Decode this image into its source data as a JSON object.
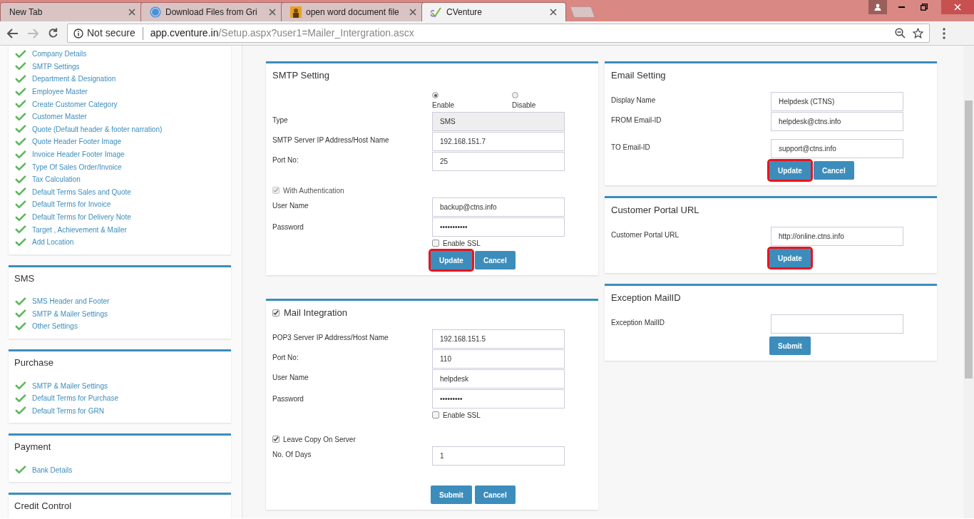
{
  "browser": {
    "tabs": [
      {
        "title": "New Tab",
        "kind": "none",
        "selected": false
      },
      {
        "title": "Download Files from Gri",
        "kind": "asp",
        "selected": false
      },
      {
        "title": "open word document file",
        "kind": "picture",
        "selected": false
      },
      {
        "title": "CVenture",
        "kind": "check",
        "selected": true
      }
    ],
    "address": {
      "security": "Not secure",
      "host": "app.cventure.in",
      "path": "/Setup.aspx?user1=Mailer_Intergration.ascx"
    }
  },
  "sidebar": [
    {
      "items": [
        "Company Details",
        "SMTP Settings",
        "Department & Designation",
        "Employee Master",
        "Create Customer Category",
        "Customer Master",
        "Quote (Default header & footer narration)",
        "Quote Header Footer Image",
        "Invoice Header Footer Image",
        "Type Of Sales Order/Invoice",
        "Tax Calculation",
        "Default Terms Sales and Quote",
        "Default Terms for Invoice",
        "Default Terms for Delivery Note",
        "Target , Achievement & Mailer",
        "Add Location"
      ]
    },
    {
      "title": "SMS",
      "items": [
        "SMS Header and Footer",
        "SMTP & Mailer Settings",
        "Other Settings"
      ]
    },
    {
      "title": "Purchase",
      "items": [
        "SMTP & Mailer Settings",
        "Default Terms for Purchase",
        "Default Terms for GRN"
      ]
    },
    {
      "title": "Payment",
      "items": [
        "Bank Details"
      ]
    },
    {
      "title": "Credit Control"
    }
  ],
  "columns": [
    [
      {
        "title": "SMTP Setting",
        "rows": [
          {
            "kind": "radio",
            "options": [
              {
                "label": "Enable",
                "selected": true
              },
              {
                "label": "Disable",
                "selected": false
              }
            ]
          },
          {
            "kind": "field",
            "label": "Type",
            "value": "SMS",
            "disabled": true
          },
          {
            "kind": "field",
            "label": "SMTP Server IP Address/Host Name",
            "value": "192.168.151.7",
            "disabled": false
          },
          {
            "kind": "field",
            "label": "Port No:",
            "value": "25",
            "disabled": false
          },
          {
            "kind": "checkbox",
            "label": "With Authentication",
            "checked": true,
            "disabled": true
          },
          {
            "kind": "field",
            "label": "User Name",
            "value": "backup@ctns.info",
            "disabled": false
          },
          {
            "kind": "field",
            "label": "Password",
            "value": "•••••••••••",
            "disabled": false,
            "option": {
              "label": "Enable SSL",
              "checked": false
            }
          },
          {
            "kind": "buttons",
            "buttons": [
              {
                "label": "Update",
                "highlighted": true
              },
              {
                "label": "Cancel",
                "highlighted": false
              }
            ]
          }
        ]
      },
      {
        "title": "Mail Integration",
        "checked": true,
        "rows": [
          {
            "kind": "field",
            "label": "POP3 Server IP Address/Host Name",
            "value": "192.168.151.5",
            "disabled": false
          },
          {
            "kind": "field",
            "label": "Port No:",
            "value": "110",
            "disabled": false
          },
          {
            "kind": "field",
            "label": "User Name",
            "value": "helpdesk",
            "disabled": false
          },
          {
            "kind": "field",
            "label": "Password",
            "value": "•••••••••",
            "disabled": false,
            "option": {
              "label": "Enable SSL",
              "checked": false
            }
          },
          {
            "kind": "checkbox",
            "label": "Leave Copy On Server",
            "checked": true,
            "disabled": false
          },
          {
            "kind": "field",
            "label": "No. Of Days",
            "value": "1",
            "disabled": false
          },
          {
            "kind": "buttons",
            "buttons": [
              {
                "label": "Submit",
                "highlighted": false
              },
              {
                "label": "Cancel",
                "highlighted": false
              }
            ]
          }
        ]
      }
    ],
    [
      {
        "title": "Email Setting",
        "rows": [
          {
            "kind": "field",
            "label": "Display Name",
            "value": "Helpdesk (CTNS)",
            "disabled": false
          },
          {
            "kind": "field",
            "label": "FROM Email-ID",
            "value": "helpdesk@ctns.info",
            "disabled": false
          },
          {
            "kind": "field",
            "label": "TO Email-ID",
            "value": "support@ctns.info",
            "disabled": false
          },
          {
            "kind": "buttons",
            "buttons": [
              {
                "label": "Update",
                "highlighted": true
              },
              {
                "label": "Cancel",
                "highlighted": false
              }
            ]
          }
        ]
      },
      {
        "title": "Customer Portal URL",
        "rows": [
          {
            "kind": "field",
            "label": "Customer Portal URL",
            "value": "http://online.ctns.info",
            "disabled": false
          },
          {
            "kind": "buttons",
            "buttons": [
              {
                "label": "Update",
                "highlighted": true
              }
            ]
          }
        ]
      },
      {
        "title": "Exception MailID",
        "rows": [
          {
            "kind": "field",
            "label": "Exception MailID",
            "disabled": false
          },
          {
            "kind": "buttons",
            "buttons": [
              {
                "label": "Submit",
                "highlighted": false
              }
            ]
          }
        ]
      }
    ]
  ]
}
